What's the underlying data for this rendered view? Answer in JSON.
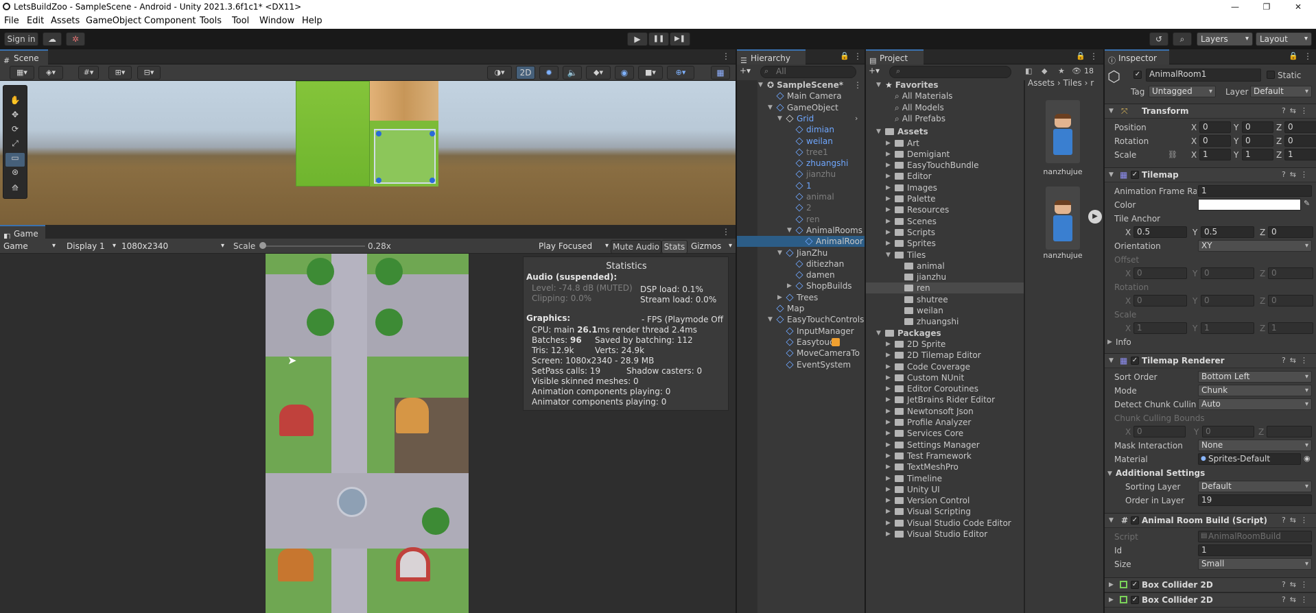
{
  "window": {
    "title": "LetsBuildZoo - SampleScene - Android - Unity 2021.3.6f1c1* <DX11>",
    "controls": [
      "—",
      "❐",
      "✕"
    ]
  },
  "menu": [
    "File",
    "Edit",
    "Assets",
    "GameObject",
    "Component",
    "Tools",
    "Tool",
    "Window",
    "Help"
  ],
  "toolbar": {
    "sign_in": "Sign in",
    "layers": "Layers",
    "layout": "Layout"
  },
  "scene": {
    "tab": "Scene",
    "mode_2d": "2D"
  },
  "game": {
    "tab": "Game",
    "view_select": "Game",
    "display": "Display 1",
    "resolution": "1080x2340",
    "scale_label": "Scale",
    "scale_value": 0.28,
    "scale_text": "0.28x",
    "play_mode": "Play Focused",
    "mute": "Mute Audio",
    "stats": "Stats",
    "gizmos": "Gizmos"
  },
  "stats": {
    "title": "Statistics",
    "audio_header": "Audio (suspended):",
    "level": "Level: -74.8 dB (MUTED)",
    "clipping": "Clipping: 0.0%",
    "dsp": "DSP load: 0.1%",
    "stream": "Stream load: 0.0%",
    "graphics_header": "Graphics:",
    "fps": "- FPS (Playmode Off",
    "cpu_prefix": "CPU: main ",
    "cpu_main": "26.1",
    "cpu_suffix": "ms  render thread 2.4ms",
    "batches_prefix": "Batches: ",
    "batches": "96",
    "saved": "Saved by batching: 112",
    "tris": "Tris: 12.9k",
    "verts": "Verts: 24.9k",
    "screen": "Screen: 1080x2340 - 28.9 MB",
    "setpass": "SetPass calls: 19",
    "shadow": "Shadow casters: 0",
    "skinned": "Visible skinned meshes: 0",
    "anim": "Animation components playing: 0",
    "animator": "Animator components playing: 0"
  },
  "hierarchy": {
    "tab": "Hierarchy",
    "search_placeholder": "All",
    "items": [
      {
        "label": "SampleScene*"
      },
      {
        "label": "Main Camera"
      },
      {
        "label": "GameObject"
      },
      {
        "label": "Grid"
      },
      {
        "label": "dimian"
      },
      {
        "label": "weilan"
      },
      {
        "label": "tree1"
      },
      {
        "label": "zhuangshi"
      },
      {
        "label": "jianzhu"
      },
      {
        "label": "1"
      },
      {
        "label": "animal"
      },
      {
        "label": "2"
      },
      {
        "label": "ren"
      },
      {
        "label": "AnimalRooms"
      },
      {
        "label": "AnimalRoor"
      },
      {
        "label": "JianZhu"
      },
      {
        "label": "ditiezhan"
      },
      {
        "label": "damen"
      },
      {
        "label": "ShopBuilds"
      },
      {
        "label": "Trees"
      },
      {
        "label": "Map"
      },
      {
        "label": "EasyTouchControls"
      },
      {
        "label": "InputManager"
      },
      {
        "label": "Easytouch"
      },
      {
        "label": "MoveCameraTo"
      },
      {
        "label": "EventSystem"
      }
    ]
  },
  "project": {
    "tab": "Project",
    "count": "18",
    "breadcrumb": [
      "Assets",
      "Tiles",
      "r"
    ],
    "favorites_header": "Favorites",
    "favorites": [
      "All Materials",
      "All Models",
      "All Prefabs"
    ],
    "assets_header": "Assets",
    "assets": [
      "Art",
      "Demigiant",
      "EasyTouchBundle",
      "Editor",
      "Images",
      "Palette",
      "Resources",
      "Scenes",
      "Scripts",
      "Sprites",
      "Tiles"
    ],
    "tiles": [
      "animal",
      "jianzhu",
      "ren",
      "shutree",
      "weilan",
      "zhuangshi"
    ],
    "packages_header": "Packages",
    "packages": [
      "2D Sprite",
      "2D Tilemap Editor",
      "Code Coverage",
      "Custom NUnit",
      "Editor Coroutines",
      "JetBrains Rider Editor",
      "Newtonsoft Json",
      "Profile Analyzer",
      "Services Core",
      "Settings Manager",
      "Test Framework",
      "TextMeshPro",
      "Timeline",
      "Unity UI",
      "Version Control",
      "Visual Scripting",
      "Visual Studio Code Editor",
      "Visual Studio Editor"
    ],
    "thumbs": [
      "nanzhujue",
      "nanzhujue"
    ]
  },
  "inspector": {
    "tab": "Inspector",
    "object_name": "AnimalRoom1",
    "static": "Static",
    "tag_label": "Tag",
    "tag": "Untagged",
    "layer_label": "Layer",
    "layer": "Default",
    "transform": {
      "title": "Transform",
      "position": "Position",
      "rotation": "Rotation",
      "scale": "Scale",
      "pos": [
        "0",
        "0",
        "0"
      ],
      "rot": [
        "0",
        "0",
        "0"
      ],
      "scl": [
        "1",
        "1",
        "1"
      ]
    },
    "tilemap": {
      "title": "Tilemap",
      "frame_rate_label": "Animation Frame Rate",
      "frame_rate": "1",
      "color_label": "Color",
      "anchor_label": "Tile Anchor",
      "anchor": [
        "0.5",
        "0.5",
        "0"
      ],
      "orientation_label": "Orientation",
      "orientation": "XY",
      "offset_label": "Offset",
      "offset": [
        "0",
        "0",
        "0"
      ],
      "rotation_label": "Rotation",
      "rotation": [
        "0",
        "0",
        "0"
      ],
      "scale_label": "Scale",
      "scale": [
        "1",
        "1",
        "1"
      ],
      "info": "Info"
    },
    "renderer": {
      "title": "Tilemap Renderer",
      "sort_order_label": "Sort Order",
      "sort_order": "Bottom Left",
      "mode_label": "Mode",
      "mode": "Chunk",
      "culling_label": "Detect Chunk Culling",
      "culling": "Auto",
      "bounds_label": "Chunk Culling Bounds",
      "bounds": [
        "0",
        "0"
      ],
      "mask_label": "Mask Interaction",
      "mask": "None",
      "material_label": "Material",
      "material": "Sprites-Default",
      "additional": "Additional Settings",
      "sorting_layer_label": "Sorting Layer",
      "sorting_layer": "Default",
      "order_label": "Order in Layer",
      "order": "19"
    },
    "script": {
      "title": "Animal Room Build (Script)",
      "script_label": "Script",
      "script": "AnimalRoomBuild",
      "id_label": "Id",
      "id": "1",
      "size_label": "Size",
      "size": "Small"
    },
    "colliders": [
      "Box Collider 2D",
      "Box Collider 2D"
    ]
  },
  "axis_letters": [
    "X",
    "Y",
    "Z"
  ]
}
